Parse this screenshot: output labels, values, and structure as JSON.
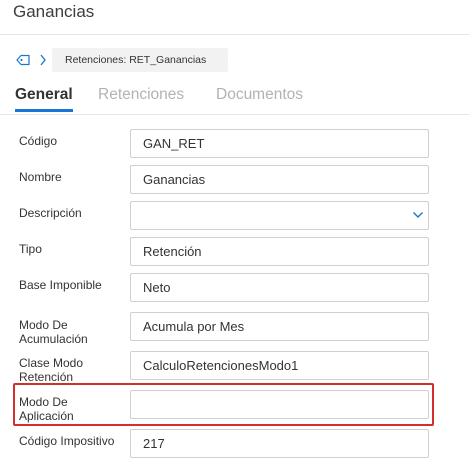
{
  "page": {
    "title": "Ganancias"
  },
  "breadcrumb": {
    "current": "Retenciones: RET_Ganancias"
  },
  "tabs": [
    {
      "label": "General",
      "active": true
    },
    {
      "label": "Retenciones",
      "active": false
    },
    {
      "label": "Documentos",
      "active": false
    }
  ],
  "form": {
    "codigo": {
      "label": "Código",
      "value": "GAN_RET"
    },
    "nombre": {
      "label": "Nombre",
      "value": "Ganancias"
    },
    "descripcion": {
      "label": "Descripción",
      "value": ""
    },
    "tipo": {
      "label": "Tipo",
      "value": "Retención"
    },
    "base_imponible": {
      "label": "Base Imponible",
      "value": "Neto"
    },
    "modo_acumulacion": {
      "label": "Modo De Acumulación",
      "value": "Acumula por Mes"
    },
    "clase_modo_retencion": {
      "label": "Clase Modo Retención",
      "value": "CalculoRetencionesModo1"
    },
    "modo_aplicacion": {
      "label": "Modo De Aplicación",
      "value": ""
    },
    "codigo_impositivo": {
      "label": "Código Impositivo",
      "value": "217"
    }
  },
  "colors": {
    "accent": "#1976d2",
    "highlight": "#d32f2f"
  },
  "icons": {
    "breadcrumb": "tag-icon",
    "separator": "chevron-right-icon",
    "select": "chevron-down-icon"
  }
}
